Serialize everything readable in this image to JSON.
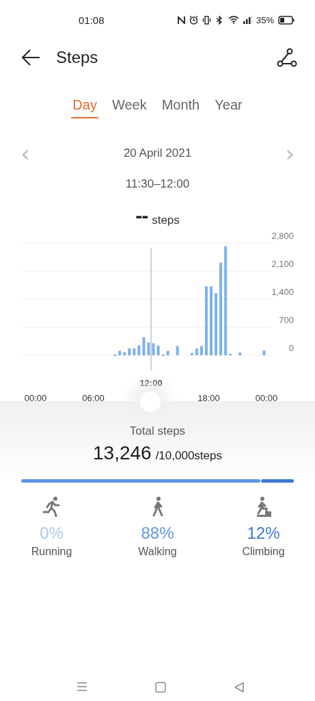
{
  "status_bar": {
    "time": "01:08",
    "battery": "35%"
  },
  "header": {
    "title": "Steps"
  },
  "tabs": [
    {
      "label": "Day",
      "selected": true
    },
    {
      "label": "Week",
      "selected": false
    },
    {
      "label": "Month",
      "selected": false
    },
    {
      "label": "Year",
      "selected": false
    }
  ],
  "date": {
    "prev": "‹",
    "label": "20 April 2021",
    "next": "›"
  },
  "range": "11:30–12:00",
  "reading": {
    "value": "--",
    "unit": "steps"
  },
  "chart_data": {
    "type": "bar",
    "x": [
      8,
      8.5,
      9,
      9.5,
      10,
      10.5,
      11,
      11.5,
      12,
      12.5,
      13,
      13.5,
      14.5,
      16,
      16.5,
      17,
      17.5,
      18,
      18.5,
      19,
      19.5,
      20,
      21,
      23.5
    ],
    "values": [
      20,
      110,
      80,
      170,
      170,
      250,
      450,
      320,
      300,
      240,
      20,
      110,
      230,
      60,
      170,
      230,
      1720,
      1720,
      1550,
      2310,
      2720,
      40,
      70,
      120
    ],
    "xlim": [
      0,
      24
    ],
    "xticks": [
      {
        "value": 0,
        "label": "00:00"
      },
      {
        "value": 6,
        "label": "06:00"
      },
      {
        "value": 18,
        "label": "18:00"
      },
      {
        "value": 24,
        "label": "00:00"
      }
    ],
    "ylim": [
      0,
      2800
    ],
    "yticks": [
      {
        "value": 0,
        "label": "0"
      },
      {
        "value": 700,
        "label": "700"
      },
      {
        "value": 1400,
        "label": "1,400"
      },
      {
        "value": 2100,
        "label": "2,100"
      },
      {
        "value": 2800,
        "label": "2,800"
      }
    ],
    "grid": true,
    "ref_lines": [
      {
        "axis": "x",
        "value": 12,
        "label": "12:00"
      }
    ]
  },
  "total": {
    "label": "Total steps",
    "value": "13,246",
    "goal": "/10,000steps"
  },
  "activities": [
    {
      "kind": "running",
      "percent": "0%",
      "label": "Running",
      "color": "#a9c7f0"
    },
    {
      "kind": "walking",
      "percent": "88%",
      "label": "Walking",
      "color": "#5f95e2"
    },
    {
      "kind": "climbing",
      "percent": "12%",
      "label": "Climbing",
      "color": "#3b76d6"
    }
  ]
}
